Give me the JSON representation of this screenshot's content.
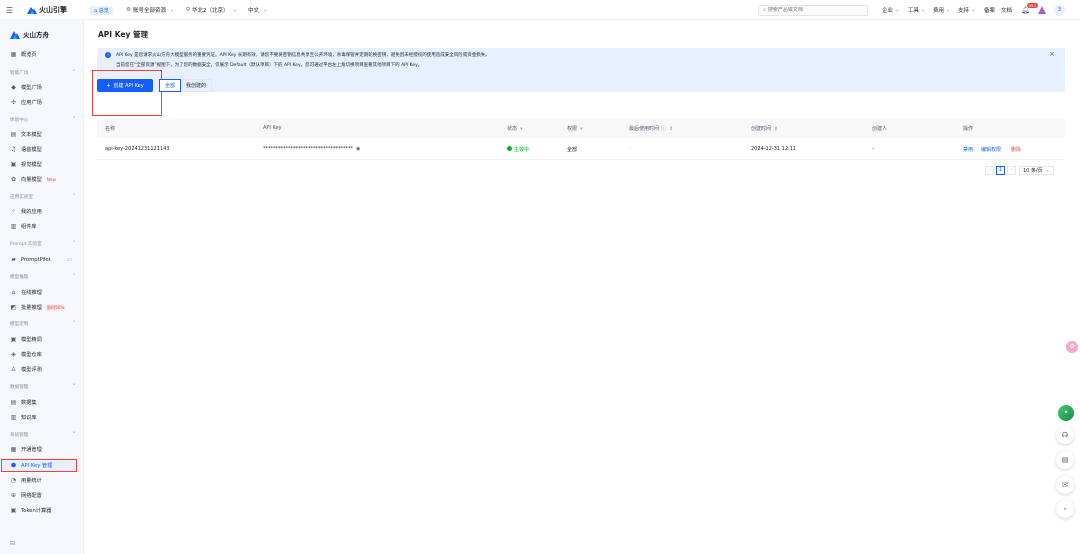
{
  "topbar": {
    "brand": "火山引擎",
    "overview": "总览",
    "resource_scope": "账号全部资源",
    "region": "华北2（北京）",
    "language": "中文",
    "search_placeholder": "搜索产品或文档",
    "menus": [
      "企业",
      "工具",
      "费用",
      "支持"
    ],
    "links": [
      "备案",
      "文档"
    ],
    "notification_badge": "99+",
    "avatar": "3"
  },
  "sidebar": {
    "product": "火山方舟",
    "overview": "概览页",
    "sections": [
      {
        "title": "智能广场",
        "items": [
          {
            "label": "模型广场"
          },
          {
            "label": "应用广场"
          }
        ]
      },
      {
        "title": "体验中心",
        "items": [
          {
            "label": "文本模型"
          },
          {
            "label": "语音模型"
          },
          {
            "label": "视觉模型"
          },
          {
            "label": "向量模型",
            "tag": "New"
          }
        ]
      },
      {
        "title": "应用实验室",
        "items": [
          {
            "label": "我的应用"
          },
          {
            "label": "组件库"
          }
        ]
      },
      {
        "title": "Prompt 实验室",
        "items": [
          {
            "label": "PromptPilot"
          }
        ]
      },
      {
        "title": "模型推理",
        "items": [
          {
            "label": "在线推理"
          },
          {
            "label": "批量推理",
            "tag": "限时50%"
          }
        ]
      },
      {
        "title": "模型定制",
        "items": [
          {
            "label": "模型精调"
          },
          {
            "label": "模型仓库"
          },
          {
            "label": "模型评测"
          }
        ]
      },
      {
        "title": "数据管理",
        "items": [
          {
            "label": "数据集"
          },
          {
            "label": "知识库"
          }
        ]
      },
      {
        "title": "系统管理",
        "items": [
          {
            "label": "开通管理"
          },
          {
            "label": "API Key 管理"
          },
          {
            "label": "用量统计"
          },
          {
            "label": "网络配置"
          },
          {
            "label": "Token计算器"
          }
        ]
      }
    ]
  },
  "main": {
    "title": "API Key 管理",
    "alert_line1": "API Key 是您请求火山方舟大模型服务的重要凭证。API Key 长期有效，请您不要将密钥信息共享至公开环境，杀毒保管并定期轮换密钥，避免因未经授权的使用造成安全风险或资金损失。",
    "alert_line2": "当前您在“全部资源”视图下，为了您的数据安全，仅展示 Default（默认项目）下的 API Key。您可通过平台左上角切换项目查看其他项目下的 API Key。",
    "create_button": "创建 API Key",
    "filters": [
      "全部",
      "我创建的"
    ],
    "columns": [
      "名称",
      "API Key",
      "状态",
      "权限",
      "最后使用时间",
      "创建时间",
      "创建人",
      "操作"
    ],
    "rows": [
      {
        "name": "api-key-20241231121143",
        "key": "************************************",
        "status": "生效中",
        "permission": "全部",
        "last_used": "-",
        "created": "2024-12-31 12:11",
        "creator": "-",
        "actions": [
          "禁用",
          "编辑权限",
          "删除"
        ]
      }
    ],
    "pagination": {
      "current": "1",
      "page_size": "10 条/页"
    }
  },
  "colors": {
    "accent": "#165dff",
    "danger": "#f53f3f",
    "success": "#00b42a",
    "sidebar_bg": "#f6f8fb",
    "alert_bg": "#e8f0ff"
  }
}
